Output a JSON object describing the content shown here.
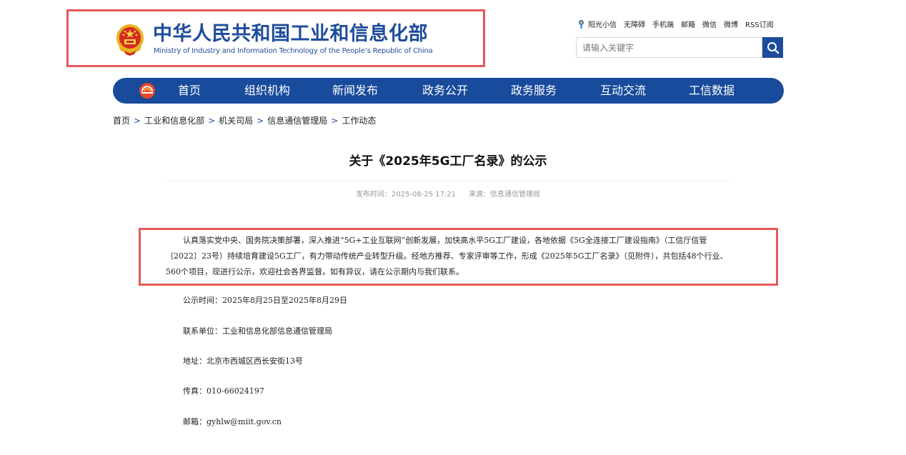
{
  "header": {
    "logo_cn": "中华人民共和国工业和信息化部",
    "logo_en": "Ministry of Industry and Information Technology of the People’s Republic of China",
    "emblem_icon": "national-emblem-icon",
    "top_links": [
      "阳光小信",
      "无障碍",
      "手机端",
      "邮箱",
      "微信",
      "微博",
      "RSS订阅"
    ],
    "search_placeholder": "请输入关键字",
    "search_icon": "search-icon"
  },
  "nav": {
    "items": [
      "首页",
      "组织机构",
      "新闻发布",
      "政务公开",
      "政务服务",
      "互动交流",
      "工信数据"
    ]
  },
  "breadcrumb": {
    "items": [
      "首页",
      "工业和信息化部",
      "机关司局",
      "信息通信管理局",
      "工作动态"
    ],
    "separator": ">"
  },
  "article": {
    "title": "关于《2025年5G工厂名录》的公示",
    "publish_label": "发布时间：2025-08-25 17:21",
    "source_label": "来源：信息通信管理局",
    "intro": "认真落实党中央、国务院决策部署，深入推进“5G+工业互联网”创新发展，加快高水平5G工厂建设，各地依据《5G全连接工厂建设指南》（工信厅信管〔2022〕23号）持续培育建设5G工厂，有力带动传统产业转型升级。经地方推荐、专家评审等工作，形成《2025年5G工厂名录》（见附件），共包括48个行业、560个项目，现进行公示，欢迎社会各界监督。如有异议，请在公示期内与我们联系。",
    "details": [
      "公示时间：2025年8月25日至2025年8月29日",
      "联系单位：工业和信息化部信息通信管理局",
      "地址：北京市西城区西长安街13号",
      "传真：010-66024197",
      "邮箱：gyhlw@miit.gov.cn"
    ]
  },
  "colors": {
    "brand_blue": "#1d4c9c",
    "nav_blue": "#184b9b",
    "highlight_red": "#e35a5a"
  }
}
